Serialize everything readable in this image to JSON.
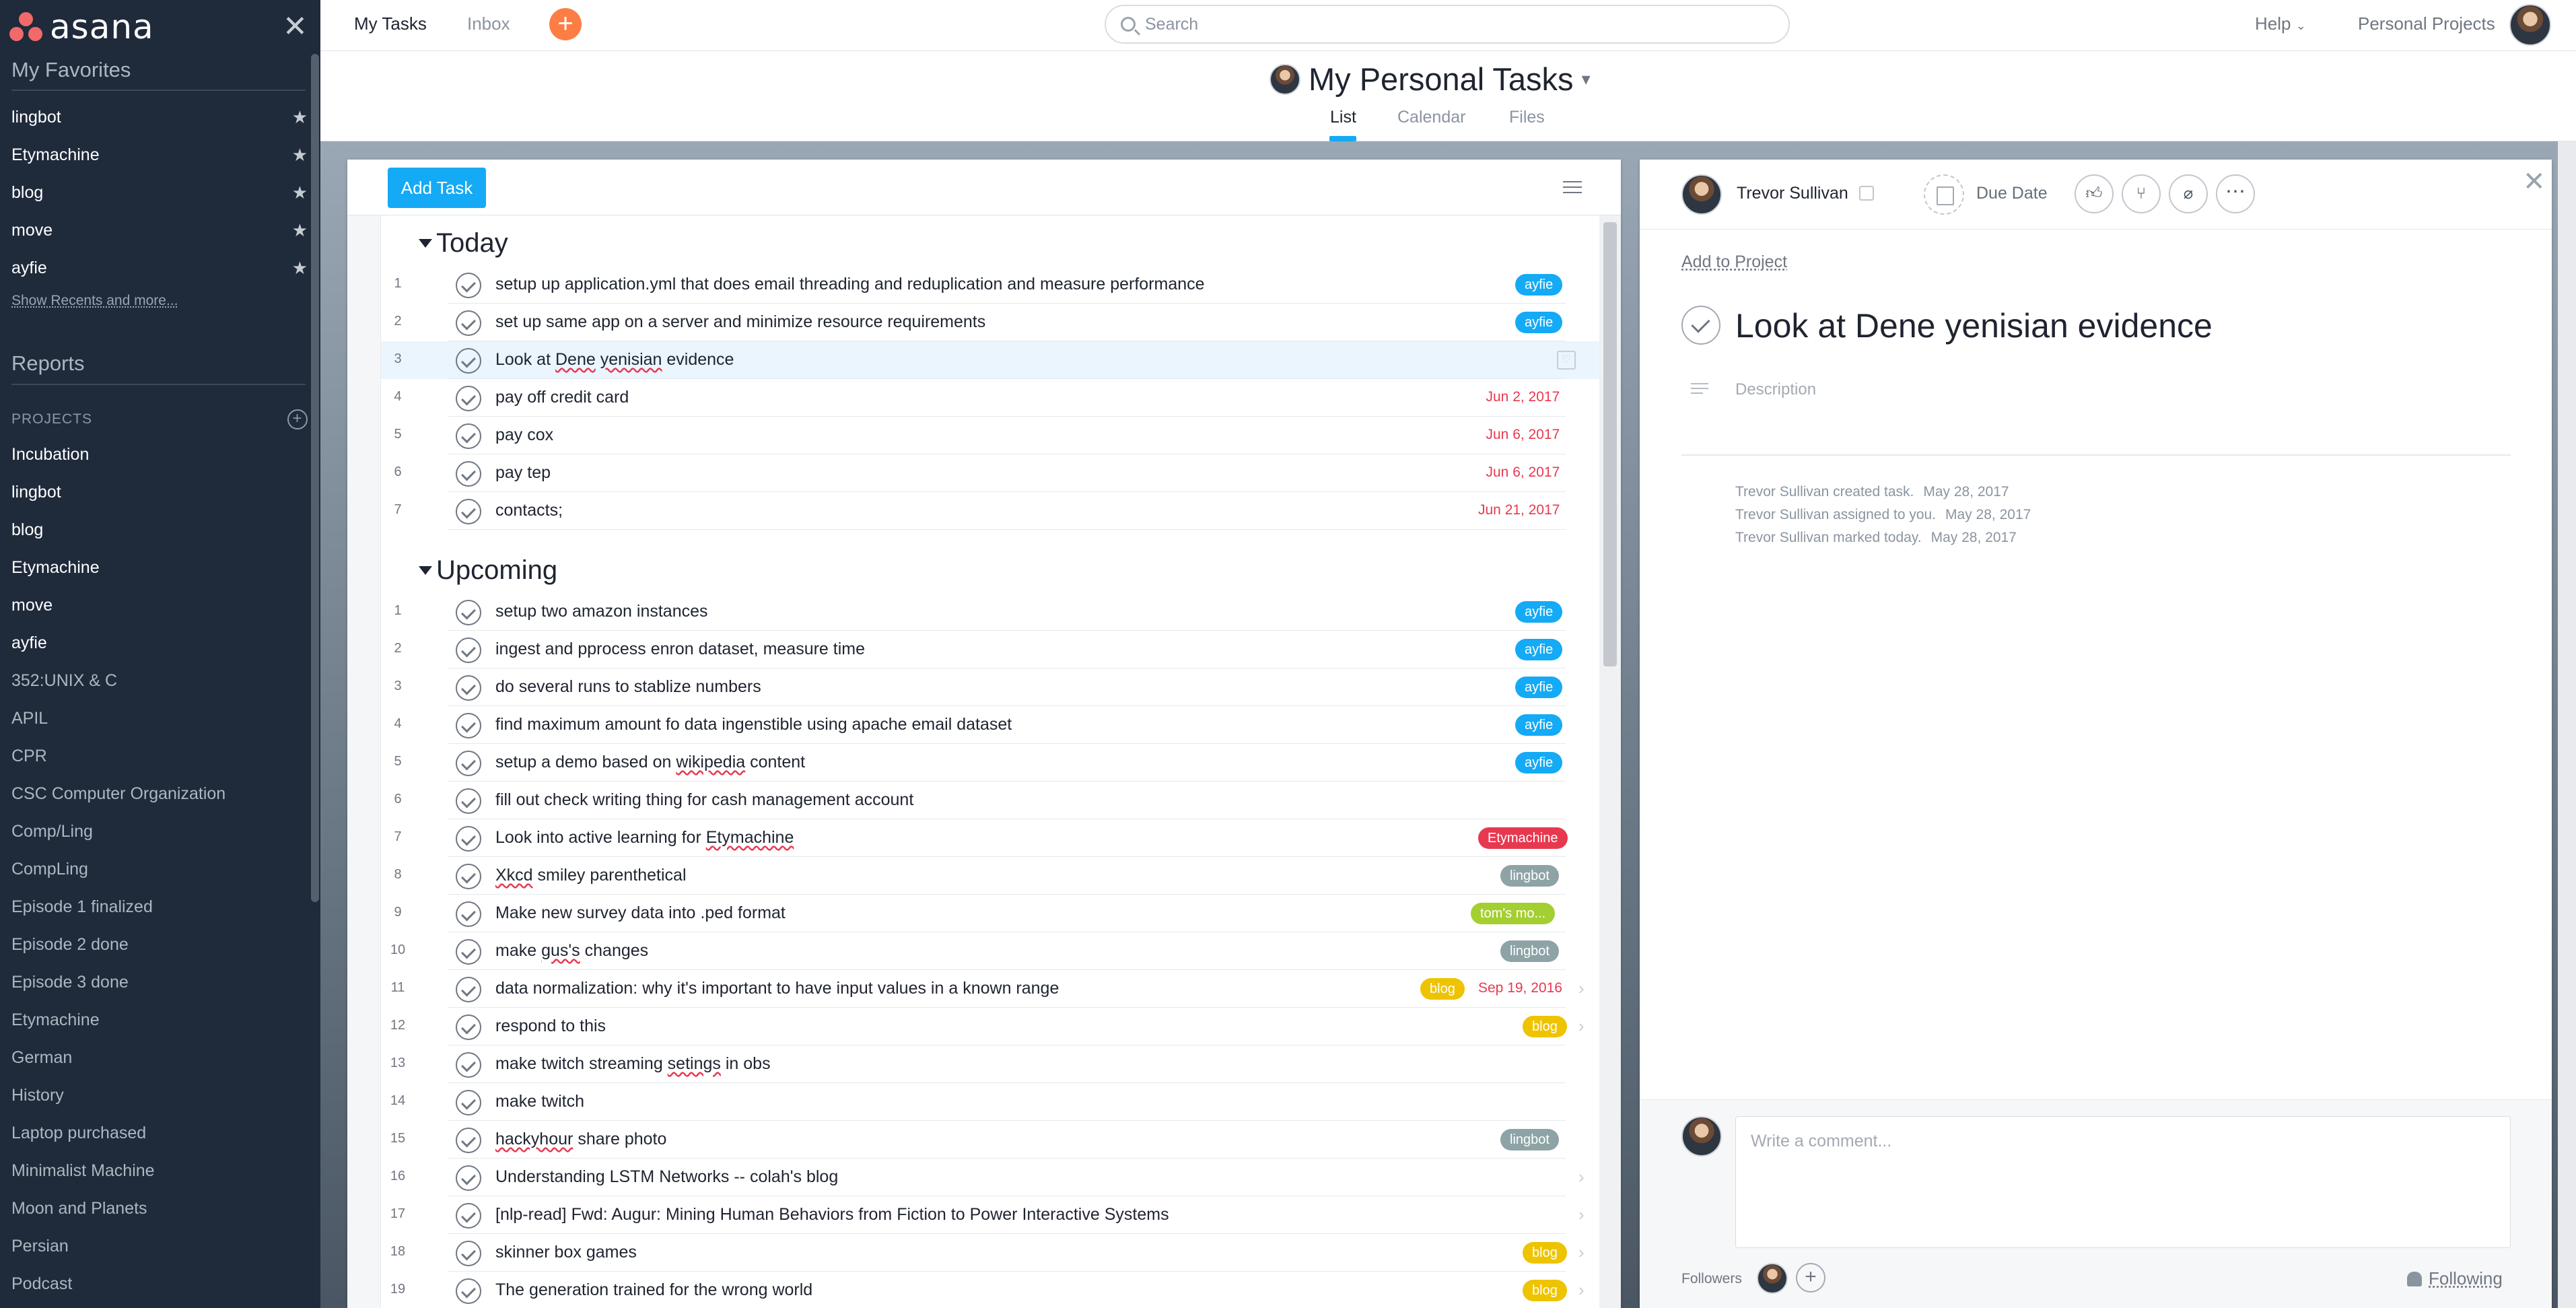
{
  "sidebar": {
    "brand": "asana",
    "favorites_heading": "My Favorites",
    "favorites": [
      "lingbot",
      "Etymachine",
      "blog",
      "move",
      "ayfie"
    ],
    "show_recents": "Show Recents and more...",
    "reports_heading": "Reports",
    "projects_heading": "PROJECTS",
    "projects": [
      "Incubation",
      "lingbot",
      "blog",
      "Etymachine",
      "move",
      "ayfie",
      "352:UNIX & C",
      "APIL",
      "CPR",
      "CSC Computer Organization",
      "Comp/Ling",
      "CompLing",
      "Episode 1 finalized",
      "Episode 2 done",
      "Episode 3 done",
      "Etymachine",
      "German",
      "History",
      "Laptop purchased",
      "Minimalist Machine",
      "Moon and Planets",
      "Persian",
      "Podcast"
    ]
  },
  "topbar": {
    "my_tasks": "My Tasks",
    "inbox": "Inbox",
    "search_placeholder": "Search",
    "help": "Help",
    "personal_projects": "Personal Projects"
  },
  "page": {
    "title": "My Personal Tasks",
    "tabs": [
      "List",
      "Calendar",
      "Files"
    ],
    "active_tab": "List"
  },
  "list": {
    "add_task": "Add Task",
    "sections": [
      {
        "title": "Today",
        "tasks": [
          {
            "num": "1",
            "text": "setup up application.yml that does email threading and reduplication and measure performance",
            "tag": "ayfie",
            "tag_class": "t-ayfie"
          },
          {
            "num": "2",
            "text": "set up same app on a server and minimize resource requirements",
            "tag": "ayfie",
            "tag_class": "t-ayfie"
          },
          {
            "num": "3",
            "text": "Look at Dene yenisian evidence",
            "selected": true
          },
          {
            "num": "4",
            "text": "pay off credit card",
            "due": "Jun 2, 2017"
          },
          {
            "num": "5",
            "text": "pay cox",
            "due": "Jun 6, 2017"
          },
          {
            "num": "6",
            "text": "pay tep",
            "due": "Jun 6, 2017"
          },
          {
            "num": "7",
            "text": "contacts;",
            "due": "Jun 21, 2017"
          }
        ]
      },
      {
        "title": "Upcoming",
        "tasks": [
          {
            "num": "1",
            "text": "setup two amazon instances",
            "tag": "ayfie",
            "tag_class": "t-ayfie"
          },
          {
            "num": "2",
            "text": "ingest and pprocess enron dataset, measure time",
            "tag": "ayfie",
            "tag_class": "t-ayfie"
          },
          {
            "num": "3",
            "text": "do several runs to stablize numbers",
            "tag": "ayfie",
            "tag_class": "t-ayfie"
          },
          {
            "num": "4",
            "text": "find maximum amount fo data ingenstible using apache email dataset",
            "tag": "ayfie",
            "tag_class": "t-ayfie"
          },
          {
            "num": "5",
            "text": "setup a demo based on wikipedia content",
            "tag": "ayfie",
            "tag_class": "t-ayfie"
          },
          {
            "num": "6",
            "text": "fill out check writing thing for cash management account"
          },
          {
            "num": "7",
            "text": "Look into active learning for Etymachine",
            "tag": "Etymachine",
            "tag_class": "t-etym"
          },
          {
            "num": "8",
            "text": "Xkcd smiley parenthetical",
            "tag": "lingbot",
            "tag_class": "t-ling"
          },
          {
            "num": "9",
            "text": "Make new survey data into .ped format",
            "tag": "tom's mo...",
            "tag_class": "t-toms"
          },
          {
            "num": "10",
            "text": "make gus's changes",
            "tag": "lingbot",
            "tag_class": "t-ling"
          },
          {
            "num": "11",
            "text": "data normalization: why it's important to have input values in a known range",
            "tag": "blog",
            "tag_class": "t-blog",
            "due": "Sep 19, 2016",
            "chevron": true
          },
          {
            "num": "12",
            "text": "respond to this",
            "tag": "blog",
            "tag_class": "t-blog",
            "chevron": true
          },
          {
            "num": "13",
            "text": "make twitch streaming setings in obs"
          },
          {
            "num": "14",
            "text": "make twitch"
          },
          {
            "num": "15",
            "text": "hackyhour share photo",
            "tag": "lingbot",
            "tag_class": "t-ling"
          },
          {
            "num": "16",
            "text": "Understanding LSTM Networks -- colah's blog",
            "chevron": true
          },
          {
            "num": "17",
            "text": "[nlp-read] Fwd: Augur: Mining Human Behaviors from Fiction to Power Interactive Systems",
            "chevron": true
          },
          {
            "num": "18",
            "text": "skinner box games",
            "tag": "blog",
            "tag_class": "t-blog",
            "chevron": true
          },
          {
            "num": "19",
            "text": "The generation trained for the wrong world",
            "tag": "blog",
            "tag_class": "t-blog",
            "chevron": true
          }
        ]
      }
    ]
  },
  "detail": {
    "assignee": "Trevor Sullivan",
    "due_date": "Due Date",
    "add_to_project": "Add to Project",
    "title": "Look at Dene yenisian evidence",
    "description_placeholder": "Description",
    "stories": [
      {
        "text": "Trevor Sullivan created task.",
        "date": "May 28, 2017"
      },
      {
        "text": "Trevor Sullivan assigned to you.",
        "date": "May 28, 2017"
      },
      {
        "text": "Trevor Sullivan marked today.",
        "date": "May 28, 2017"
      }
    ],
    "comment_placeholder": "Write a comment...",
    "followers_label": "Followers",
    "following": "Following"
  },
  "colors": {
    "sidebar_bg": "#1f2a3b",
    "accent": "#14aaf5",
    "due_red": "#e8384f",
    "add_orange": "#fc7e45"
  }
}
